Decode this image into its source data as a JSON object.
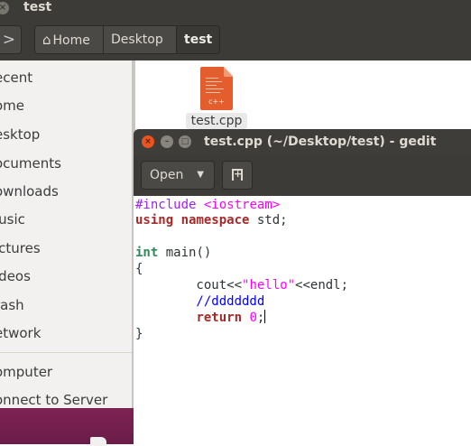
{
  "file_manager": {
    "title": "test",
    "back_icon": ">",
    "path": {
      "home": "Home",
      "desktop": "Desktop",
      "test": "test"
    },
    "sidebar": [
      "ecent",
      "ome",
      "esktop",
      "ocuments",
      "ownloads",
      "lusic",
      "ictures",
      "ideos",
      "rash",
      "etwork",
      "omputer",
      "onnect to Server"
    ],
    "file": {
      "name": "test.cpp",
      "icon_text": "c++",
      "icon_color": "#e35e2c"
    }
  },
  "gedit": {
    "title": "test.cpp (~/Desktop/test) - gedit",
    "open_label": "Open",
    "code": {
      "l1_pre": "#include",
      "l1_inc": "<iostream>",
      "l2_kw1": "using",
      "l2_kw2": "namespace",
      "l2_rest": " std;",
      "l4_type": "int",
      "l4_rest": " main()",
      "l5": "{",
      "l6_pre": "        cout<<",
      "l6_str": "\"hello\"",
      "l6_post": "<<endl;",
      "l7_cmt": "        //ddddddd",
      "l8_kw": "return",
      "l8_num": "0",
      "l8_post": ";",
      "l9": "}"
    },
    "colors": {
      "keyword": "#a52a2a",
      "type": "#2e8b57",
      "string": "#ff00ff",
      "comment": "#0000ff",
      "preprocessor": "#a020f0"
    }
  }
}
